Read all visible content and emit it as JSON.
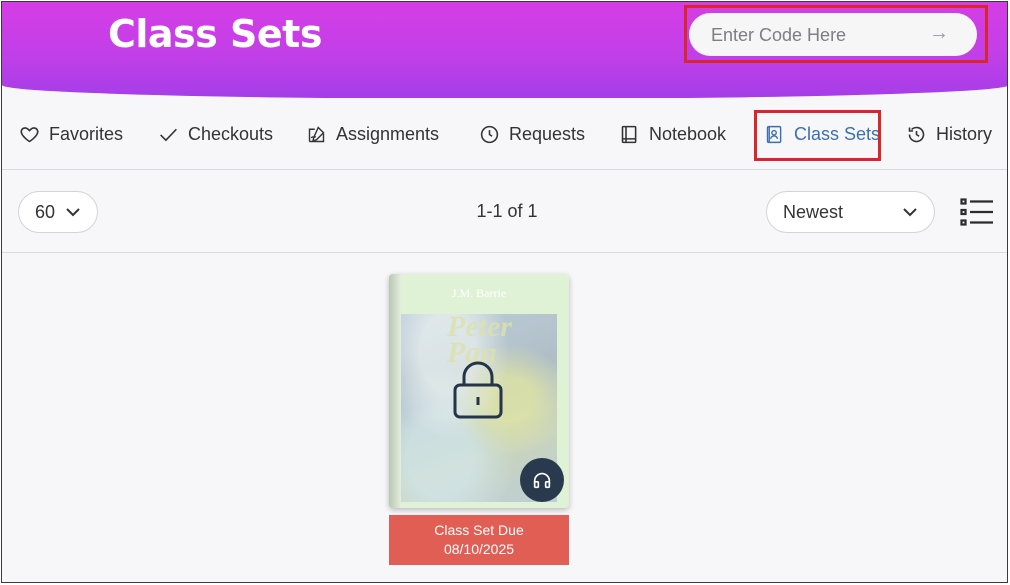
{
  "header": {
    "title": "Class Sets",
    "code_input": {
      "placeholder": "Enter Code Here",
      "value": ""
    }
  },
  "tabs": [
    {
      "label": "Favorites",
      "icon": "heart-icon"
    },
    {
      "label": "Checkouts",
      "icon": "check-icon"
    },
    {
      "label": "Assignments",
      "icon": "assignment-icon"
    },
    {
      "label": "Requests",
      "icon": "clock-icon"
    },
    {
      "label": "Notebook",
      "icon": "notebook-icon"
    },
    {
      "label": "Class Sets",
      "icon": "class-sets-icon",
      "active": true
    },
    {
      "label": "History",
      "icon": "history-icon"
    }
  ],
  "toolbar": {
    "page_size": "60",
    "count_text": "1-1 of 1",
    "sort": "Newest"
  },
  "items": [
    {
      "cover_author": "J.M. Barrie",
      "cover_title": "Peter Pan",
      "locked": true,
      "audiobook": true,
      "due_label": "Class Set Due",
      "due_date": "08/10/2025"
    }
  ],
  "colors": {
    "header_gradient_start": "#d63de6",
    "header_gradient_end": "#a43ee8",
    "active_tab": "#3b6fb3",
    "due_banner": "#e15e54",
    "highlight_box": "#d8262a"
  }
}
